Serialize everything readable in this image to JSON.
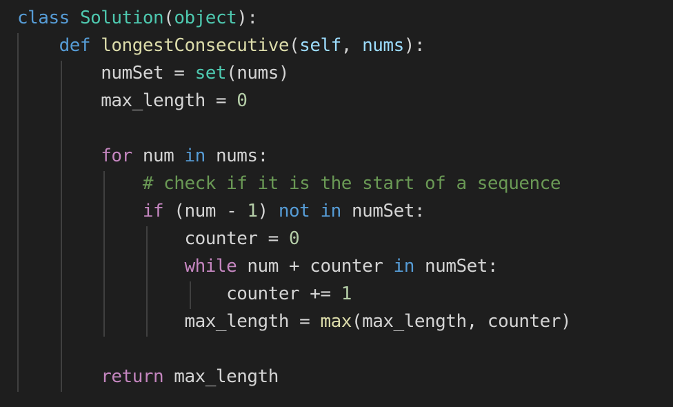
{
  "editor": {
    "theme_colors": {
      "background": "#1e1e1e",
      "keyword_blue": "#569cd6",
      "keyword_purple": "#c586c0",
      "class_name": "#4ec9b0",
      "function_name": "#dcdcaa",
      "parameter": "#9cdcfe",
      "number": "#b5cea8",
      "comment": "#6a9955",
      "text": "#d4d4d4"
    },
    "lines": [
      [
        {
          "t": "class",
          "c": "kw-blue"
        },
        {
          "t": " ",
          "c": "plain"
        },
        {
          "t": "Solution",
          "c": "cls"
        },
        {
          "t": "(",
          "c": "plain"
        },
        {
          "t": "object",
          "c": "cls"
        },
        {
          "t": "):",
          "c": "plain"
        }
      ],
      [
        {
          "t": "    ",
          "c": "plain"
        },
        {
          "t": "def",
          "c": "kw-blue"
        },
        {
          "t": " ",
          "c": "plain"
        },
        {
          "t": "longestConsecutive",
          "c": "fn"
        },
        {
          "t": "(",
          "c": "plain"
        },
        {
          "t": "self",
          "c": "param"
        },
        {
          "t": ", ",
          "c": "plain"
        },
        {
          "t": "nums",
          "c": "param"
        },
        {
          "t": "):",
          "c": "plain"
        }
      ],
      [
        {
          "t": "        numSet = ",
          "c": "plain"
        },
        {
          "t": "set",
          "c": "cls"
        },
        {
          "t": "(nums)",
          "c": "plain"
        }
      ],
      [
        {
          "t": "        max_length = ",
          "c": "plain"
        },
        {
          "t": "0",
          "c": "num"
        }
      ],
      [],
      [
        {
          "t": "        ",
          "c": "plain"
        },
        {
          "t": "for",
          "c": "kw-purple"
        },
        {
          "t": " num ",
          "c": "plain"
        },
        {
          "t": "in",
          "c": "kw-blue"
        },
        {
          "t": " nums:",
          "c": "plain"
        }
      ],
      [
        {
          "t": "            ",
          "c": "plain"
        },
        {
          "t": "# check if it is the start of a sequence",
          "c": "comment"
        }
      ],
      [
        {
          "t": "            ",
          "c": "plain"
        },
        {
          "t": "if",
          "c": "kw-purple"
        },
        {
          "t": " (num - ",
          "c": "plain"
        },
        {
          "t": "1",
          "c": "num"
        },
        {
          "t": ") ",
          "c": "plain"
        },
        {
          "t": "not",
          "c": "kw-blue"
        },
        {
          "t": " ",
          "c": "plain"
        },
        {
          "t": "in",
          "c": "kw-blue"
        },
        {
          "t": " numSet:",
          "c": "plain"
        }
      ],
      [
        {
          "t": "                counter = ",
          "c": "plain"
        },
        {
          "t": "0",
          "c": "num"
        }
      ],
      [
        {
          "t": "                ",
          "c": "plain"
        },
        {
          "t": "while",
          "c": "kw-purple"
        },
        {
          "t": " num + counter ",
          "c": "plain"
        },
        {
          "t": "in",
          "c": "kw-blue"
        },
        {
          "t": " numSet:",
          "c": "plain"
        }
      ],
      [
        {
          "t": "                    counter += ",
          "c": "plain"
        },
        {
          "t": "1",
          "c": "num"
        }
      ],
      [
        {
          "t": "                max_length = ",
          "c": "plain"
        },
        {
          "t": "max",
          "c": "fn"
        },
        {
          "t": "(max_length, counter)",
          "c": "plain"
        }
      ],
      [],
      [
        {
          "t": "        ",
          "c": "plain"
        },
        {
          "t": "return",
          "c": "kw-purple"
        },
        {
          "t": " max_length",
          "c": "plain"
        }
      ]
    ]
  }
}
